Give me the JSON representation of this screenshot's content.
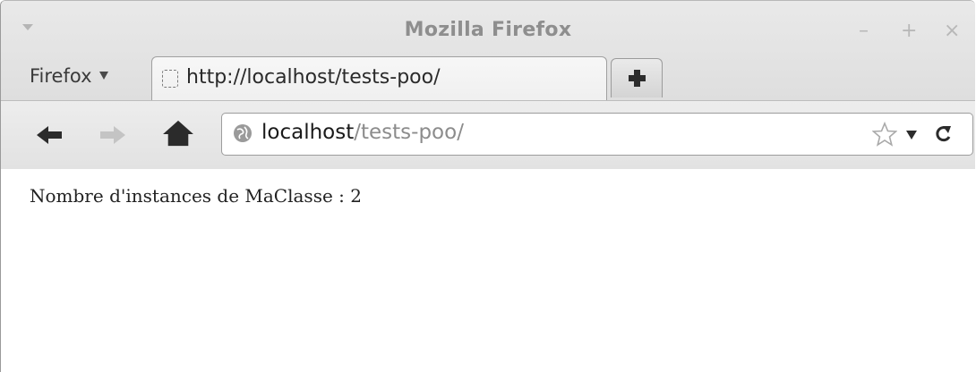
{
  "window": {
    "title": "Mozilla Firefox",
    "controls": {
      "minimize": "–",
      "maximize": "+",
      "close": "×"
    }
  },
  "tabs_row": {
    "menu_label": "Firefox",
    "active_tab": {
      "label": "http://localhost/tests-poo/",
      "icon": "page-placeholder-icon"
    },
    "new_tab_icon": "plus-icon"
  },
  "navigation": {
    "back_icon": "back-arrow-icon",
    "forward_icon": "forward-arrow-icon",
    "home_icon": "home-icon",
    "url": {
      "host": "localhost",
      "path": "/tests-poo/"
    },
    "bookmark_icon": "star-icon",
    "dropdown_icon": "chevron-down-icon",
    "reload_icon": "reload-icon"
  },
  "page": {
    "text": "Nombre d'instances de MaClasse : 2"
  },
  "colors": {
    "chrome_bg": "#e2e2e2",
    "url_path": "#8c8c8c",
    "title_text": "#8e8e8e"
  }
}
